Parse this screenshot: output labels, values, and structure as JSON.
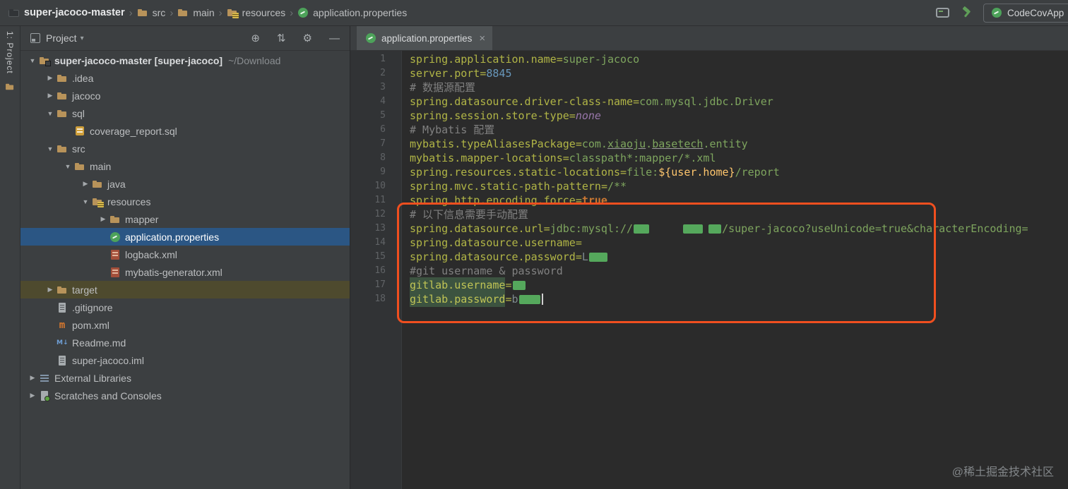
{
  "topbar": {
    "breadcrumbs": [
      {
        "label": "super-jacoco-master",
        "icon": "projectdark"
      },
      {
        "label": "src",
        "icon": "folder"
      },
      {
        "label": "main",
        "icon": "folder"
      },
      {
        "label": "resources",
        "icon": "resfolder"
      },
      {
        "label": "application.properties",
        "icon": "spring"
      }
    ],
    "icons": [
      "terminal",
      "build"
    ],
    "run_config_label": "CodeCovApp"
  },
  "stripe": {
    "label": "1: Project"
  },
  "project_panel": {
    "title": "Project",
    "actions": [
      "locate",
      "collapse-all",
      "settings",
      "hide-panel"
    ],
    "tree": [
      {
        "label": "super-jacoco-master [super-jacoco]",
        "path": "~/Download",
        "level": 0,
        "chevron": "open",
        "icon": "project",
        "bold": true
      },
      {
        "label": ".idea",
        "level": 1,
        "chevron": "closed",
        "icon": "folder"
      },
      {
        "label": "jacoco",
        "level": 1,
        "chevron": "closed",
        "icon": "folder"
      },
      {
        "label": "sql",
        "level": 1,
        "chevron": "open",
        "icon": "folder"
      },
      {
        "label": "coverage_report.sql",
        "level": 2,
        "icon": "sql"
      },
      {
        "label": "src",
        "level": 1,
        "chevron": "open",
        "icon": "folder"
      },
      {
        "label": "main",
        "level": 2,
        "chevron": "open",
        "icon": "folder"
      },
      {
        "label": "java",
        "level": 3,
        "chevron": "closed",
        "icon": "folder"
      },
      {
        "label": "resources",
        "level": 3,
        "chevron": "open",
        "icon": "resfolder"
      },
      {
        "label": "mapper",
        "level": 4,
        "chevron": "closed",
        "icon": "folder"
      },
      {
        "label": "application.properties",
        "level": 4,
        "icon": "spring",
        "state": "selected"
      },
      {
        "label": "logback.xml",
        "level": 4,
        "icon": "xml"
      },
      {
        "label": "mybatis-generator.xml",
        "level": 4,
        "icon": "xml"
      },
      {
        "label": "target",
        "level": 1,
        "chevron": "closed",
        "icon": "folder",
        "state": "modified"
      },
      {
        "label": ".gitignore",
        "level": 1,
        "icon": "gitfile"
      },
      {
        "label": "pom.xml",
        "level": 1,
        "icon": "maven"
      },
      {
        "label": "Readme.md",
        "level": 1,
        "icon": "markdown"
      },
      {
        "label": "super-jacoco.iml",
        "level": 1,
        "icon": "iml"
      },
      {
        "label": "External Libraries",
        "level": 0,
        "chevron": "closed",
        "icon": "libraries"
      },
      {
        "label": "Scratches and Consoles",
        "level": 0,
        "chevron": "closed",
        "icon": "scratches"
      }
    ]
  },
  "editor": {
    "tab": {
      "label": "application.properties",
      "icon": "spring"
    },
    "lines": [
      {
        "n": "1",
        "seg": [
          [
            "k",
            "spring.application.name"
          ],
          [
            "eq",
            "="
          ],
          [
            "v",
            "super-jacoco"
          ]
        ]
      },
      {
        "n": "2",
        "seg": [
          [
            "k",
            "server.port"
          ],
          [
            "eq",
            "="
          ],
          [
            "num",
            "8845"
          ]
        ]
      },
      {
        "n": "3",
        "seg": [
          [
            "cmt",
            "# 数据源配置"
          ]
        ]
      },
      {
        "n": "4",
        "seg": [
          [
            "k",
            "spring.datasource.driver-class-name"
          ],
          [
            "eq",
            "="
          ],
          [
            "v",
            "com.mysql.jdbc.Driver"
          ]
        ]
      },
      {
        "n": "5",
        "seg": [
          [
            "k",
            "spring.session.store-type"
          ],
          [
            "eq",
            "="
          ],
          [
            "enum",
            "none"
          ]
        ]
      },
      {
        "n": "6",
        "seg": [
          [
            "cmt",
            "# Mybatis 配置"
          ]
        ]
      },
      {
        "n": "7",
        "seg": [
          [
            "k",
            "mybatis.typeAliasesPackage"
          ],
          [
            "eq",
            "="
          ],
          [
            "v",
            "com."
          ],
          [
            "typo",
            "xiaoju"
          ],
          [
            "v",
            "."
          ],
          [
            "typo",
            "basetech"
          ],
          [
            "v",
            ".entity"
          ]
        ]
      },
      {
        "n": "8",
        "seg": [
          [
            "k",
            "mybatis.mapper-locations"
          ],
          [
            "eq",
            "="
          ],
          [
            "v",
            "classpath*:mapper/*.xml"
          ]
        ]
      },
      {
        "n": "9",
        "seg": [
          [
            "k",
            "spring.resources.static-locations"
          ],
          [
            "eq",
            "="
          ],
          [
            "v",
            "file:"
          ],
          [
            "var",
            "${user.home}"
          ],
          [
            "v",
            "/report"
          ]
        ]
      },
      {
        "n": "10",
        "seg": [
          [
            "k",
            "spring.mvc.static-path-pattern"
          ],
          [
            "eq",
            "="
          ],
          [
            "v",
            "/**"
          ]
        ]
      },
      {
        "n": "11",
        "seg": [
          [
            "k",
            "spring.http.encoding.force"
          ],
          [
            "eq",
            "="
          ],
          [
            "kw",
            "true"
          ]
        ]
      },
      {
        "n": "12",
        "seg": [
          [
            "cmt",
            "# 以下信息需要手动配置"
          ]
        ]
      },
      {
        "n": "13",
        "seg": [
          [
            "k",
            "spring.datasource.url"
          ],
          [
            "eq",
            "="
          ],
          [
            "v",
            "jdbc:mysql://"
          ],
          [
            "redact",
            "22"
          ],
          [
            "sp",
            "46"
          ],
          [
            "redact",
            "28"
          ],
          [
            "sp",
            "6"
          ],
          [
            "redact",
            "18"
          ],
          [
            "v",
            "/super-jacoco?useUnicode=true&characterEncoding="
          ]
        ]
      },
      {
        "n": "14",
        "seg": [
          [
            "k",
            "spring.datasource.username"
          ],
          [
            "eq",
            "="
          ]
        ]
      },
      {
        "n": "15",
        "seg": [
          [
            "k",
            "spring.datasource.password"
          ],
          [
            "eq",
            "="
          ],
          [
            "dim",
            "L"
          ],
          [
            "redact",
            "26"
          ]
        ]
      },
      {
        "n": "16",
        "seg": [
          [
            "cmt",
            "#git username & password"
          ]
        ]
      },
      {
        "n": "17",
        "seg": [
          [
            "khl",
            "gitlab.username"
          ],
          [
            "eq",
            "="
          ],
          [
            "redact",
            "18"
          ]
        ]
      },
      {
        "n": "18",
        "seg": [
          [
            "khl",
            "gitlab.password"
          ],
          [
            "eq",
            "="
          ],
          [
            "dim",
            "b"
          ],
          [
            "redact",
            "30"
          ],
          [
            "caret",
            ""
          ]
        ]
      }
    ]
  },
  "watermark": "@稀土掘金技术社区"
}
